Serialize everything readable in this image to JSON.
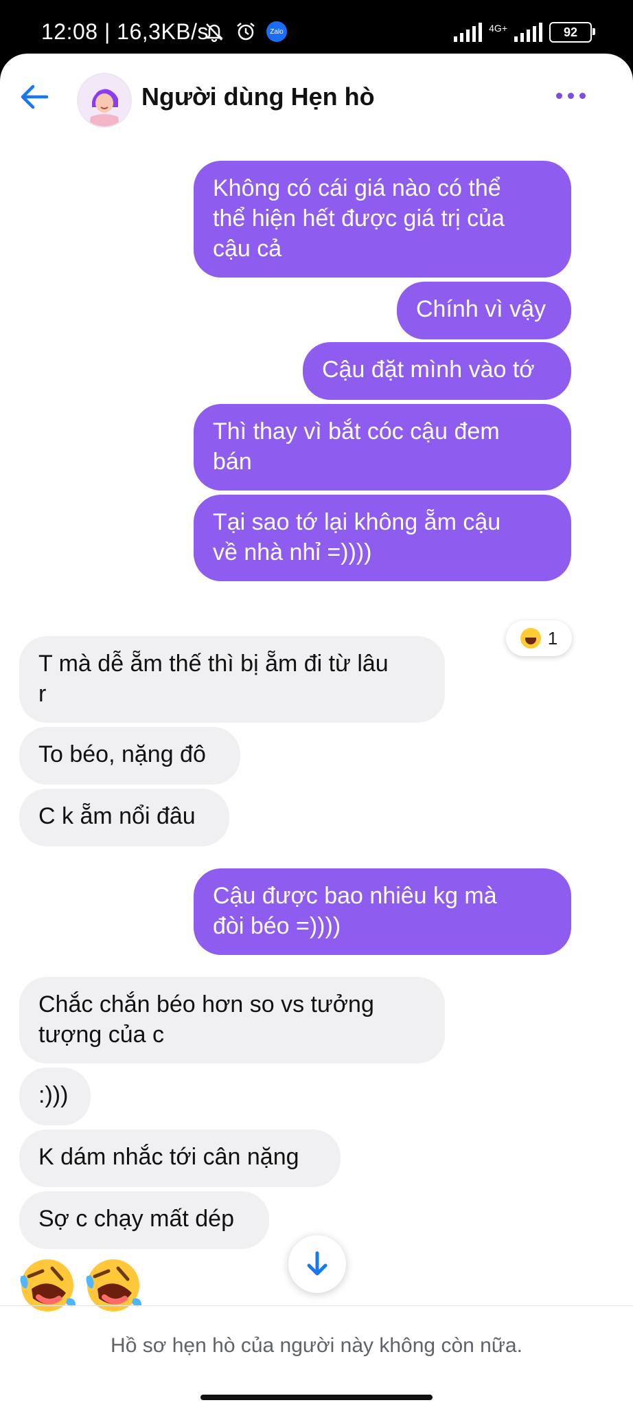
{
  "status_bar": {
    "time": "12:08 | 16,3KB/s",
    "zalo_label": "Zalo",
    "network_label": "4G+",
    "battery": "92"
  },
  "header": {
    "title": "Người dùng Hẹn hò"
  },
  "messages": [
    {
      "from": "me",
      "text": "Không có cái giá nào có thể\nthể hiện hết được giá trị của\ncậu cả"
    },
    {
      "from": "me",
      "text": "Chính vì vậy"
    },
    {
      "from": "me",
      "text": "Cậu đặt mình vào tớ"
    },
    {
      "from": "me",
      "text": "Thì thay vì bắt cóc cậu đem\nbán"
    },
    {
      "from": "me",
      "text": "Tại sao tớ lại không ẵm cậu\nvề nhà nhỉ =))))"
    },
    {
      "from": "them",
      "text": "T mà dễ ẵm thế thì bị ẵm đi từ lâu\nr"
    },
    {
      "from": "them",
      "text": "To béo, nặng đô"
    },
    {
      "from": "them",
      "text": "C k ẵm nổi đâu"
    },
    {
      "from": "me",
      "text": "Cậu được bao nhiêu kg mà\nđòi béo =))))"
    },
    {
      "from": "them",
      "text": "Chắc chắn béo hơn so vs tưởng\ntượng của c"
    },
    {
      "from": "them",
      "text": ":)))"
    },
    {
      "from": "them",
      "text": "K dám nhắc tới cân nặng"
    },
    {
      "from": "them",
      "text": "Sợ c chạy mất dép"
    }
  ],
  "reaction": {
    "icon": "laughing-emoji-icon",
    "count": "1"
  },
  "stickers": [
    "rofl-emoji-icon",
    "rofl-emoji-icon"
  ],
  "footer": {
    "text": "Hồ sơ hẹn hò của người này không còn nữa."
  },
  "colors": {
    "my_bubble": "#8f5cf0",
    "their_bubble": "#f0f0f3",
    "accent": "#7b4ce8",
    "back_arrow": "#1877f2"
  }
}
